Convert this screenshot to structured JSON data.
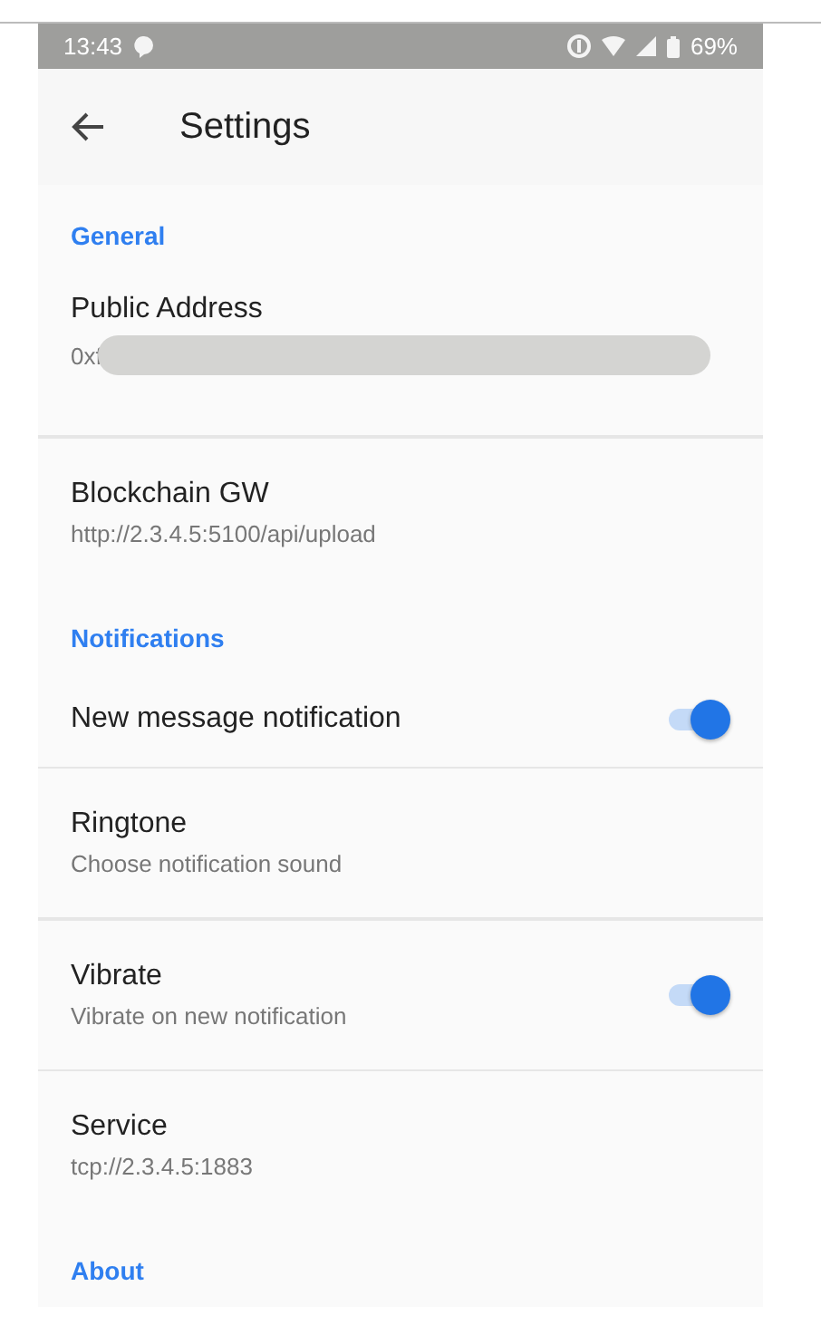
{
  "status_bar": {
    "time": "13:43",
    "battery": "69%"
  },
  "toolbar": {
    "title": "Settings"
  },
  "items": [
    {
      "kind": "header",
      "title": "General"
    },
    {
      "kind": "pref",
      "title": "Public Address",
      "summary": "0xf",
      "redacted": true
    },
    {
      "kind": "divider"
    },
    {
      "kind": "pref",
      "title": "Blockchain GW",
      "summary": "http://2.3.4.5:5100/api/upload"
    },
    {
      "kind": "header",
      "title": "Notifications"
    },
    {
      "kind": "switch",
      "title": "New message notification",
      "on": true
    },
    {
      "kind": "divider"
    },
    {
      "kind": "pref",
      "title": "Ringtone",
      "summary": "Choose notification sound"
    },
    {
      "kind": "divider"
    },
    {
      "kind": "switch",
      "title": "Vibrate",
      "summary": "Vibrate on new notification",
      "on": true
    },
    {
      "kind": "divider"
    },
    {
      "kind": "pref",
      "title": "Service",
      "summary": "tcp://2.3.4.5:1883"
    },
    {
      "kind": "header",
      "title": "About"
    }
  ]
}
